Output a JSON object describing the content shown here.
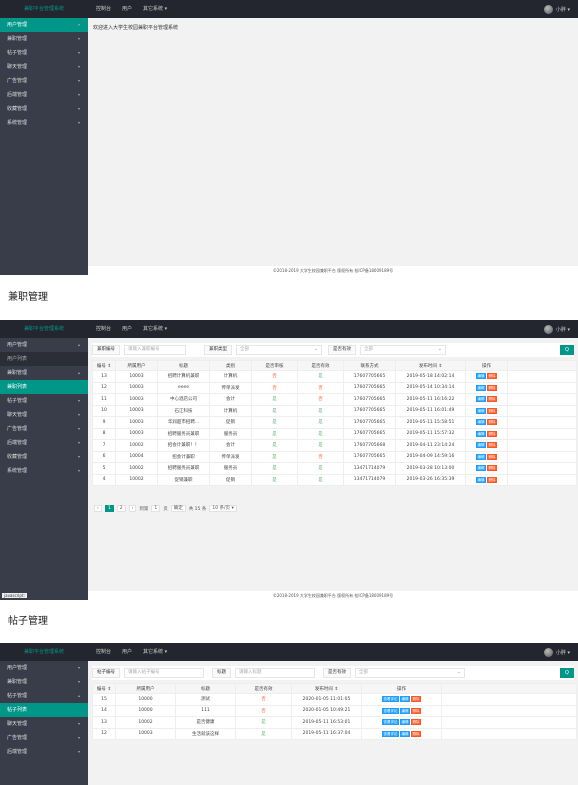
{
  "app": {
    "title": "兼职平台管理系统",
    "nav": [
      "控制台",
      "用户",
      "其它系统 ▾"
    ],
    "user": "小胖 ▾"
  },
  "welcome": "欢迎进入大学生校园兼职平台管理系统",
  "footer": "©2018-2019 大学生校园兼职平台 版权所有 桂ICP备18009189号",
  "footer2": "©2018-2019 大学生校园兼职平台 版权所有 桂ICP备18009189号",
  "footer3": "©2018-2019 大学生校园兼职平台 版权所有 桂ICP备18009189号",
  "s1": {
    "menu": [
      "用户管理",
      "兼职管理",
      "帖子管理",
      "聊天管理",
      "广告管理",
      "后端管理",
      "收藏管理",
      "系统管理"
    ]
  },
  "captions": {
    "c1": "兼职管理",
    "c2": "帖子管理"
  },
  "s2": {
    "menu": [
      "用户管理",
      "用户列表",
      "兼职管理",
      "兼职列表",
      "帖子管理",
      "聊天管理",
      "广告管理",
      "后端管理",
      "收藏管理",
      "系统管理"
    ],
    "filter": {
      "l1": "兼职编号",
      "p1": "请输入兼职编号",
      "l2": "兼职类型",
      "s2": "全部",
      "l3": "是否有效",
      "s3": "全部"
    },
    "search_icon": "Q",
    "headers": [
      "编号 ⇕",
      "所属用户",
      "标题",
      "类别",
      "是否审核",
      "是否有效",
      "联系方式",
      "发布时间 ⇕",
      "操作"
    ],
    "rows": [
      [
        "13",
        "10003",
        "招聘计算机兼职",
        "计算机",
        "否",
        "是",
        "17607705665",
        "2019-05-18 14:02:14"
      ],
      [
        "12",
        "10003",
        "eeee",
        "传单派发",
        "否",
        "否",
        "17607705665",
        "2019-05-14 10:34:14"
      ],
      [
        "11",
        "10003",
        "中心酒店公司",
        "会计",
        "是",
        "否",
        "17607705665",
        "2019-05-11 16:16:22"
      ],
      [
        "10",
        "10003",
        "石江科技",
        "计算机",
        "是",
        "是",
        "17607705665",
        "2019-05-11 16:01:49"
      ],
      [
        "9",
        "10003",
        "华润超市招聘...",
        "促销",
        "是",
        "是",
        "17607705665",
        "2019-05-11 15:58:51"
      ],
      [
        "8",
        "10003",
        "招聘服务员兼职",
        "服务员",
        "是",
        "是",
        "17607705665",
        "2019-05-11 15:57:32"
      ],
      [
        "7",
        "10002",
        "招会计兼职！！",
        "会计",
        "是",
        "是",
        "17607705668",
        "2019-04-11 23:14:24"
      ],
      [
        "6",
        "10004",
        "招会计兼职",
        "传单派发",
        "是",
        "否",
        "17607705665",
        "2019-04-09 14:59:16"
      ],
      [
        "5",
        "10002",
        "招聘服务员兼职",
        "服务员",
        "是",
        "是",
        "13471714079",
        "2019-03-28 10:13:00"
      ],
      [
        "4",
        "10002",
        "促销兼职",
        "促销",
        "是",
        "是",
        "13471714079",
        "2019-03-26 16:35:39"
      ]
    ],
    "actions": [
      "编辑",
      "删除"
    ],
    "pager": {
      "prev": "‹",
      "p1": "1",
      "p2": "2",
      "next": "›",
      "goto": "到第",
      "page": "1",
      "unit": "页",
      "confirm": "确定",
      "total": "共 15 条",
      "size": "10 条/页 ▾"
    },
    "badge": "javascript:"
  },
  "s3": {
    "menu": [
      "用户管理",
      "兼职管理",
      "帖子管理",
      "帖子列表",
      "聊天管理",
      "广告管理",
      "后端管理"
    ],
    "filter": {
      "l1": "帖子编号",
      "p1": "请输入帖子编号",
      "l2": "标题",
      "p2": "请输入标题",
      "l3": "是否有效",
      "s3": "全部"
    },
    "search_icon": "Q",
    "headers": [
      "编号 ⇕",
      "所属用户",
      "标题",
      "是否有效",
      "发布时间 ⇕",
      "操作"
    ],
    "rows": [
      [
        "15",
        "10000",
        "测试",
        "否",
        "2020-01-05 11:01:05"
      ],
      [
        "14",
        "10000",
        "111",
        "否",
        "2020-01-05 10:49:21"
      ],
      [
        "13",
        "10002",
        "是否健康",
        "是",
        "2019-05-11 16:53:01"
      ],
      [
        "12",
        "10003",
        "生活就该这样",
        "是",
        "2019-05-11 16:37:04"
      ]
    ],
    "actions": [
      "查看评论",
      "编辑",
      "删除"
    ]
  },
  "colors": {
    "accent": "#009688",
    "no": "#ff5722",
    "yes": "#5fb878",
    "blue": "#1e9fff"
  }
}
